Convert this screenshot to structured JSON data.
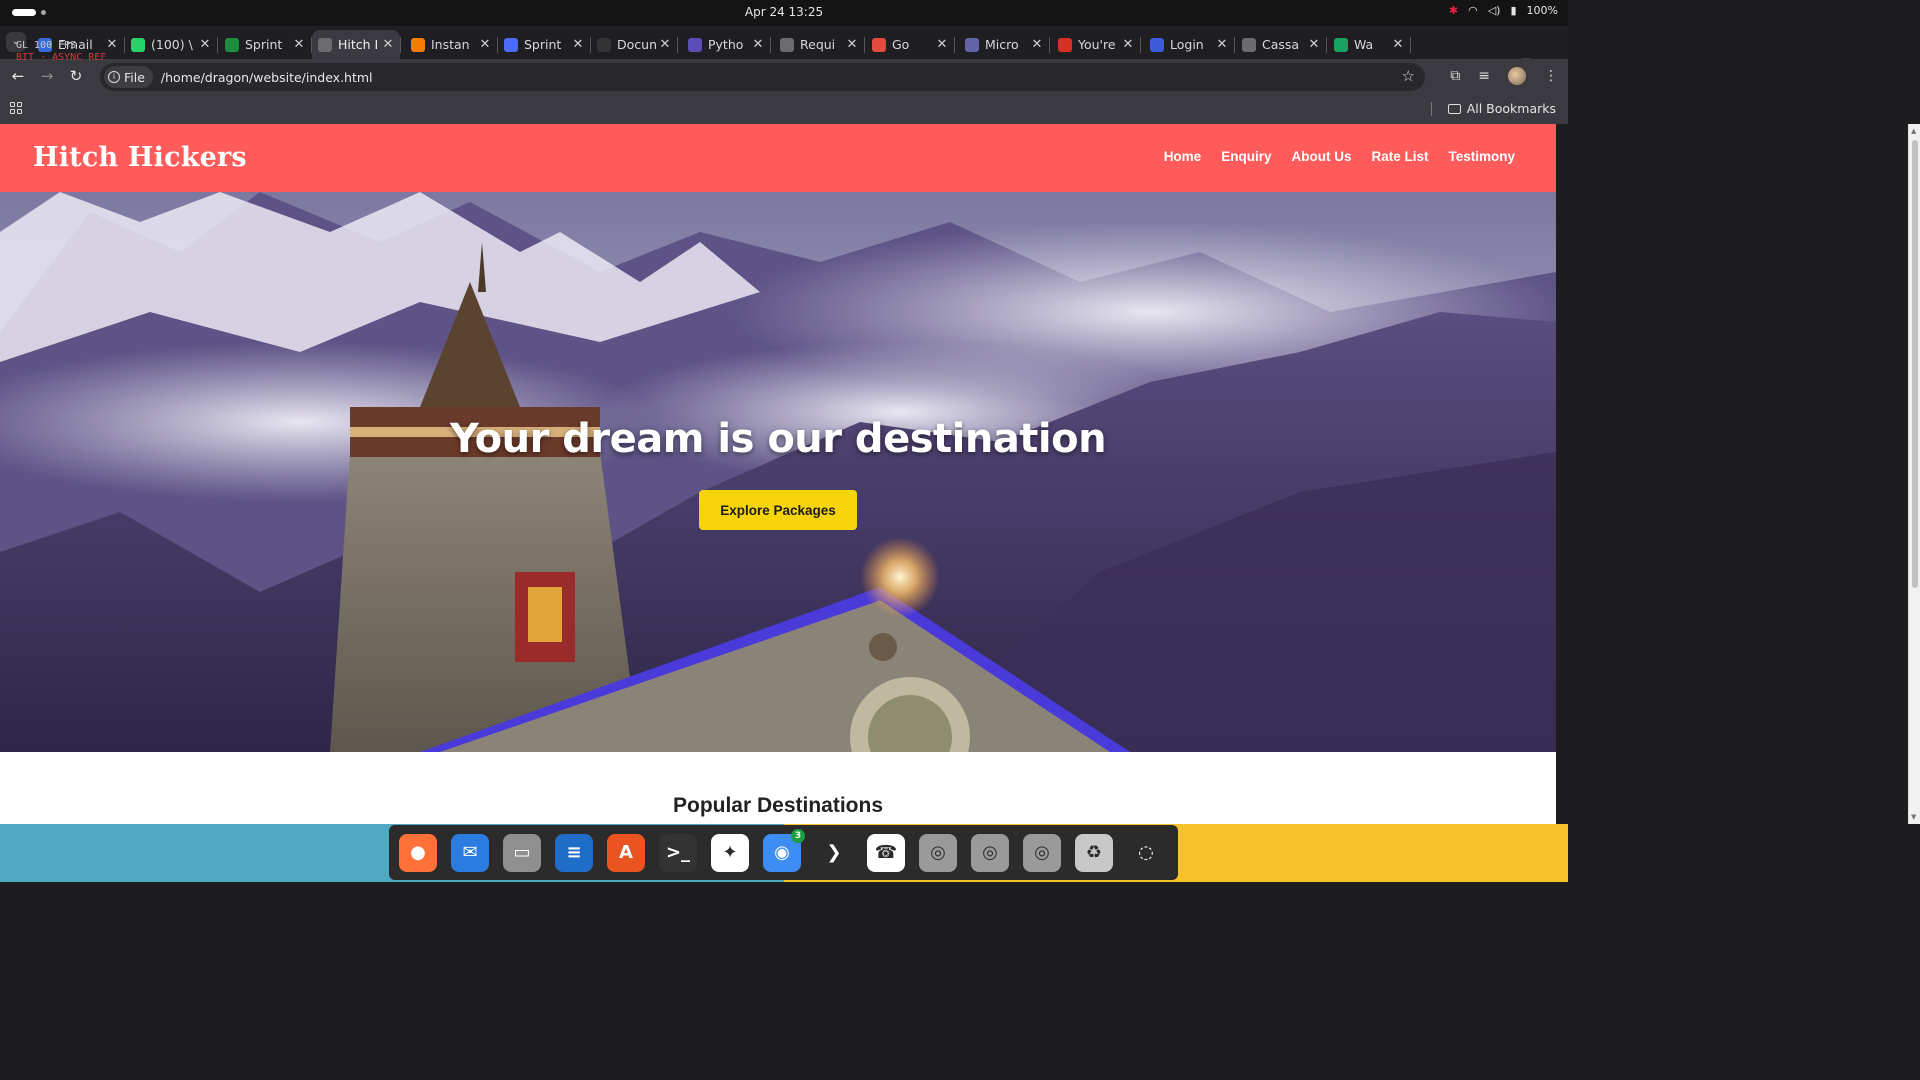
{
  "system": {
    "clock": "Apr 24  13:25",
    "battery": "100%",
    "fps_line1": "GL 100 FPS",
    "fps_line2": "BIT · ASYNC REF"
  },
  "browser": {
    "tabs": [
      {
        "title": "Email",
        "favicon": "email-favicon",
        "color": "#3a6ad9"
      },
      {
        "title": "(100) \\",
        "favicon": "whatsapp-favicon",
        "color": "#25d366"
      },
      {
        "title": "Sprint",
        "favicon": "sheets-favicon",
        "color": "#1e8e3e"
      },
      {
        "title": "Hitch I",
        "favicon": "page-favicon",
        "color": "#6b6b70"
      },
      {
        "title": "Instan",
        "favicon": "instance-favicon",
        "color": "#f57c00"
      },
      {
        "title": "Sprint",
        "favicon": "jira-favicon",
        "color": "#4a6cf7"
      },
      {
        "title": "Docun",
        "favicon": "github-favicon",
        "color": "#333"
      },
      {
        "title": "Pytho",
        "favicon": "python-favicon",
        "color": "#5b4db5"
      },
      {
        "title": "Requi",
        "favicon": "globe-favicon",
        "color": "#6b6b70"
      },
      {
        "title": "Go",
        "favicon": "chrome-favicon",
        "color": "#e04b3f"
      },
      {
        "title": "Micro",
        "favicon": "teams-favicon",
        "color": "#6264a7"
      },
      {
        "title": "You're",
        "favicon": "gmail-favicon",
        "color": "#d93025"
      },
      {
        "title": "Login",
        "favicon": "c-favicon",
        "color": "#3b5bdb"
      },
      {
        "title": "Cassa",
        "favicon": "globe-favicon",
        "color": "#6b6b70"
      },
      {
        "title": "Wa",
        "favicon": "meet-favicon",
        "color": "#1aa260"
      }
    ],
    "address": {
      "chip_label": "File",
      "url": "/home/dragon/website/index.html"
    },
    "bookmarks": {
      "all_label": "All Bookmarks"
    }
  },
  "site": {
    "brand": "Hitch Hickers",
    "nav": [
      "Home",
      "Enquiry",
      "About Us",
      "Rate List",
      "Testimony"
    ],
    "hero_title": "Your dream is our destination",
    "hero_button": "Explore Packages",
    "section_title": "Popular Destinations",
    "colors": {
      "navbar": "#ff5b5b",
      "button": "#f5d40a"
    }
  },
  "dock": {
    "apps": [
      {
        "name": "firefox-icon",
        "color": "#ff7139",
        "glyph": "●"
      },
      {
        "name": "thunderbird-icon",
        "color": "#2a7ce0",
        "glyph": "✉"
      },
      {
        "name": "files-icon",
        "color": "#8f8f8f",
        "glyph": "▭"
      },
      {
        "name": "writer-icon",
        "color": "#1f6cc9",
        "glyph": "≡"
      },
      {
        "name": "app-center-icon",
        "color": "#e95420",
        "glyph": "A"
      },
      {
        "name": "terminal-icon",
        "color": "#333333",
        "glyph": ">_"
      },
      {
        "name": "slack-icon",
        "color": "#ffffff",
        "glyph": "✦"
      },
      {
        "name": "chrome-icon",
        "color": "#3d8df5",
        "glyph": "◉",
        "badge": "3"
      },
      {
        "name": "vscode-icon",
        "color": "#2b2b2b",
        "glyph": "❯"
      },
      {
        "name": "whatsapp-icon",
        "color": "#ffffff",
        "glyph": "☎"
      },
      {
        "name": "disk-icon-1",
        "color": "#9a9a9a",
        "glyph": "◎"
      },
      {
        "name": "disk-icon-2",
        "color": "#9a9a9a",
        "glyph": "◎"
      },
      {
        "name": "disk-icon-3",
        "color": "#9a9a9a",
        "glyph": "◎"
      },
      {
        "name": "trash-icon",
        "color": "#c8c8c8",
        "glyph": "♻"
      },
      {
        "name": "ubuntu-icon",
        "color": "#2b2b2b",
        "glyph": "◌"
      }
    ]
  }
}
